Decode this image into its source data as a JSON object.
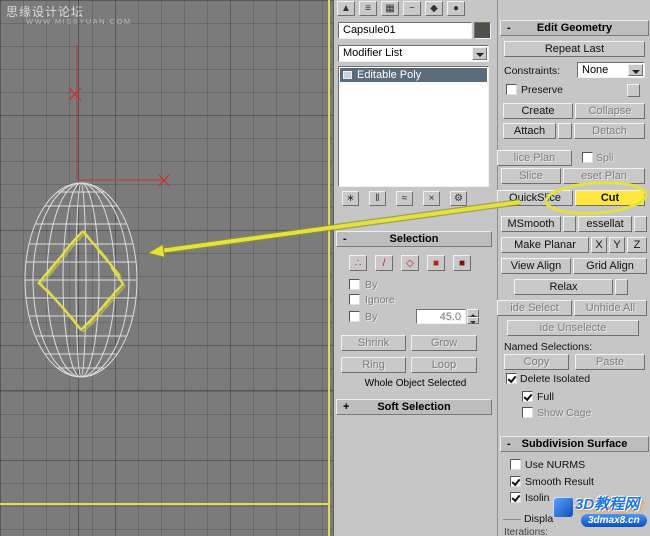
{
  "watermark": {
    "title": "思缘设计论坛",
    "url": "WWW.MISSYUAN.COM"
  },
  "signs": {
    "minus": "-",
    "plus": "+"
  },
  "colors": {
    "highlight_button": "#ffe83e",
    "annotation": "#e3e23e",
    "viewport_bg": "#7b7b7b",
    "stack_selected": "#5c6b7c"
  },
  "top_toolbar": {
    "icons": [
      {
        "name": "mirror",
        "glyph": "▲"
      },
      {
        "name": "align",
        "glyph": "≡"
      },
      {
        "name": "layer-manager",
        "glyph": "▦"
      },
      {
        "name": "curve-editor",
        "glyph": "~"
      },
      {
        "name": "schematic-view",
        "glyph": "◆"
      },
      {
        "name": "render",
        "glyph": "●"
      }
    ]
  },
  "command_panel": {
    "object_name": "Capsule01",
    "modifier_list": "Modifier List",
    "stack_item": "Editable Poly"
  },
  "stack_tools": {
    "icons": [
      {
        "name": "pin-stack",
        "glyph": "∗"
      },
      {
        "name": "show-end-result",
        "glyph": "‖"
      },
      {
        "name": "make-unique",
        "glyph": "≈"
      },
      {
        "name": "remove-modifier",
        "glyph": "×"
      },
      {
        "name": "configure-modifier-sets",
        "glyph": "⚙"
      }
    ]
  },
  "selection_icons": [
    {
      "name": "vertex",
      "glyph": "∴"
    },
    {
      "name": "edge",
      "glyph": "/"
    },
    {
      "name": "border",
      "glyph": "◇"
    },
    {
      "name": "polygon",
      "glyph": "■"
    },
    {
      "name": "element",
      "glyph": "■"
    }
  ],
  "selection": {
    "title": "Selection",
    "by_vertex": "By",
    "ignore": "Ignore",
    "by_angle": "By",
    "angle": "45.0",
    "shrink": "Shrink",
    "grow": "Grow",
    "ring": "Ring",
    "loop": "Loop",
    "status": "Whole Object Selected"
  },
  "soft_selection": {
    "title": "Soft Selection"
  },
  "eg": {
    "title": "Edit Geometry",
    "repeat_last": "Repeat Last",
    "constraints_label": "Constraints:",
    "constraints_value": "None",
    "preserve": "Preserve",
    "create": "Create",
    "collapse": "Collapse",
    "attach": "Attach",
    "detach": "Detach",
    "slice_plane": "lice Plan",
    "split": "Spli",
    "slice": "Slice",
    "reset_plane": "eset Plan",
    "quickslice": "QuickSlice",
    "cut": "Cut",
    "msmooth": "MSmooth",
    "tessellate": "essellat",
    "make_planar": "Make Planar",
    "axis_x": "X",
    "axis_y": "Y",
    "axis_z": "Z",
    "view_align": "View Align",
    "grid_align": "Grid Align",
    "relax": "Relax",
    "hide_selected": "ide Select",
    "unhide_all": "Unhide All",
    "hide_unselected": "ide Unselecte",
    "named_selections": "Named Selections:",
    "copy": "Copy",
    "paste": "Paste",
    "delete_isolated": "Delete Isolated",
    "full": "Full",
    "show_cage": "Show Cage"
  },
  "sub": {
    "title": "Subdivision Surface",
    "use_nurms": "Use NURMS",
    "smooth_result": "Smooth Result",
    "isoline": "Isolin",
    "display": "Displa",
    "iterations": "Iterations:"
  },
  "logo": {
    "title": "3D教程网",
    "site": "3dmax8.cn"
  }
}
